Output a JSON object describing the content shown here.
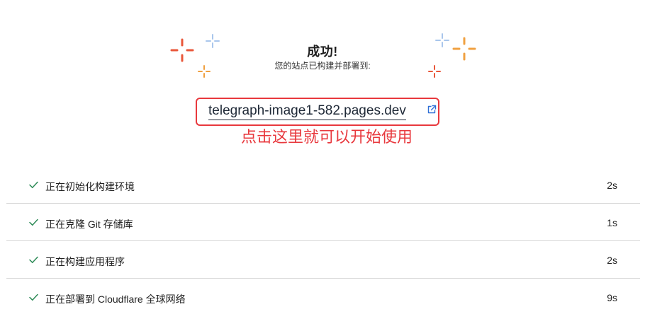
{
  "hero": {
    "title": "成功!",
    "subtitle": "您的站点已构建并部署到:"
  },
  "site": {
    "url_text": "telegraph-image1-582.pages.dev",
    "annotation": "点击这里就可以开始使用"
  },
  "steps": [
    {
      "label": "正在初始化构建环境",
      "duration": "2s"
    },
    {
      "label": "正在克隆 Git 存储库",
      "duration": "1s"
    },
    {
      "label": "正在构建应用程序",
      "duration": "2s"
    },
    {
      "label": "正在部署到 Cloudflare 全球网络",
      "duration": "9s"
    }
  ],
  "colors": {
    "sparkle_red": "#e9573a",
    "sparkle_orange": "#f0a040",
    "sparkle_blue": "#a9c6ec",
    "annotation_red": "#e8383d",
    "check_green": "#2e8b57",
    "link_icon_blue": "#2f6fd6"
  },
  "icons": {
    "sparkle": "sparkle-icon",
    "external": "external-link-icon",
    "check": "check-icon"
  }
}
